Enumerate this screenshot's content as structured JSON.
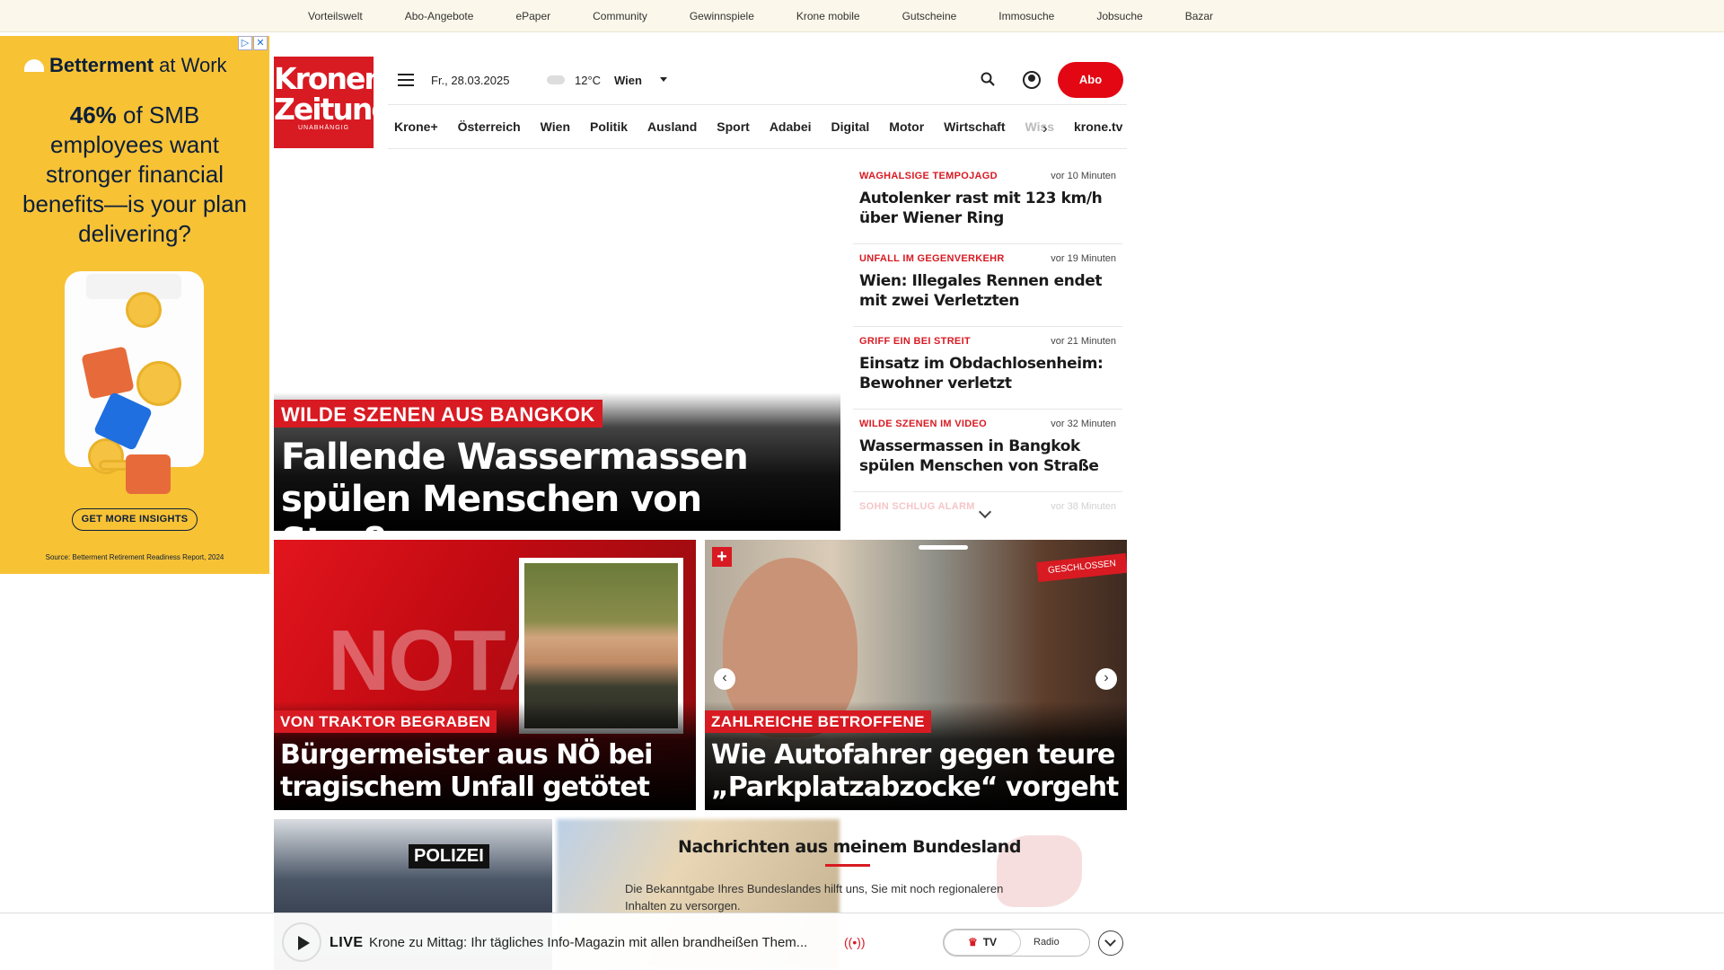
{
  "topbar": {
    "links": [
      "Vorteilswelt",
      "Abo-Angebote",
      "ePaper",
      "Community",
      "Gewinnspiele",
      "Krone mobile",
      "Gutscheine",
      "Immosuche",
      "Jobsuche",
      "Bazar"
    ]
  },
  "ad": {
    "brand": "Betterment",
    "brand_suffix": "at Work",
    "headline_strong": "46%",
    "headline_rest": " of SMB employees want stronger financial benefits—is your plan delivering?",
    "cta": "GET MORE INSIGHTS",
    "source": "Source: Betterment Retirement Readiness Report, 2024"
  },
  "header": {
    "logo_line1": "Kronen",
    "logo_line2": "Zeitung",
    "logo_tagline": "UNABHÄNGIG",
    "date": "Fr., 28.03.2025",
    "temperature": "12°C",
    "city": "Wien",
    "abo_label": "Abo"
  },
  "nav": {
    "items": [
      "Krone+",
      "Österreich",
      "Wien",
      "Politik",
      "Ausland",
      "Sport",
      "Adabei",
      "Digital",
      "Motor",
      "Wirtschaft",
      "Wiss"
    ],
    "tv_link": "krone.tv"
  },
  "hero": {
    "kicker": "WILDE SZENEN AUS BANGKOK",
    "title": "Fallende Wassermassen spülen Menschen von Straße"
  },
  "ticker": [
    {
      "kicker": "WAGHALSIGE TEMPOJAGD",
      "time": "vor 10 Minuten",
      "headline": "Autolenker rast mit 123 km/h über Wiener Ring"
    },
    {
      "kicker": "UNFALL IM GEGENVERKEHR",
      "time": "vor 19 Minuten",
      "headline": "Wien: Illegales Rennen endet mit zwei Verletzten"
    },
    {
      "kicker": "GRIFF EIN BEI STREIT",
      "time": "vor 21 Minuten",
      "headline": "Einsatz im Obdachlosenheim: Bewohner verletzt"
    },
    {
      "kicker": "WILDE SZENEN IM VIDEO",
      "time": "vor 32 Minuten",
      "headline": "Wassermassen in Bangkok spülen Menschen von Straße"
    },
    {
      "kicker": "SOHN SCHLUG ALARM",
      "time": "vor 38 Minuten",
      "headline": ""
    }
  ],
  "cards": [
    {
      "kicker": "VON TRAKTOR BEGRABEN",
      "title": "Bürgermeister aus NÖ bei tragischem Unfall getötet",
      "image_text": "NOTAR"
    },
    {
      "kicker": "ZAHLREICHE BETROFFENE",
      "title": "Wie Autofahrer gegen teure „Parkplatzabzocke“ vorgeht",
      "image_text": "GESCHLOSSEN"
    }
  ],
  "bottom": {
    "image_text": "POLIZEI",
    "bundesland_title": "Nachrichten aus meinem Bundesland",
    "bundesland_text": "Die Bekanntgabe Ihres Bundeslandes hilft uns, Sie mit noch regionaleren Inhalten zu versorgen."
  },
  "livebar": {
    "live_label": "LIVE",
    "text": "Krone zu Mittag: Ihr tägliches Info-Magazin mit allen brandheißen Them...",
    "tv_label": "TV",
    "radio_label": "Radio"
  },
  "colors": {
    "accent": "#d81a22",
    "ad_bg": "#f8c235",
    "topbar_bg": "#fbf7ea"
  },
  "icons": [
    "hamburger-icon",
    "cloud-icon",
    "caret-icon",
    "search-icon",
    "user-icon",
    "chevron-right-icon",
    "plus-icon",
    "play-icon",
    "radio-wave-icon",
    "crown-icon",
    "chevron-down-icon"
  ]
}
